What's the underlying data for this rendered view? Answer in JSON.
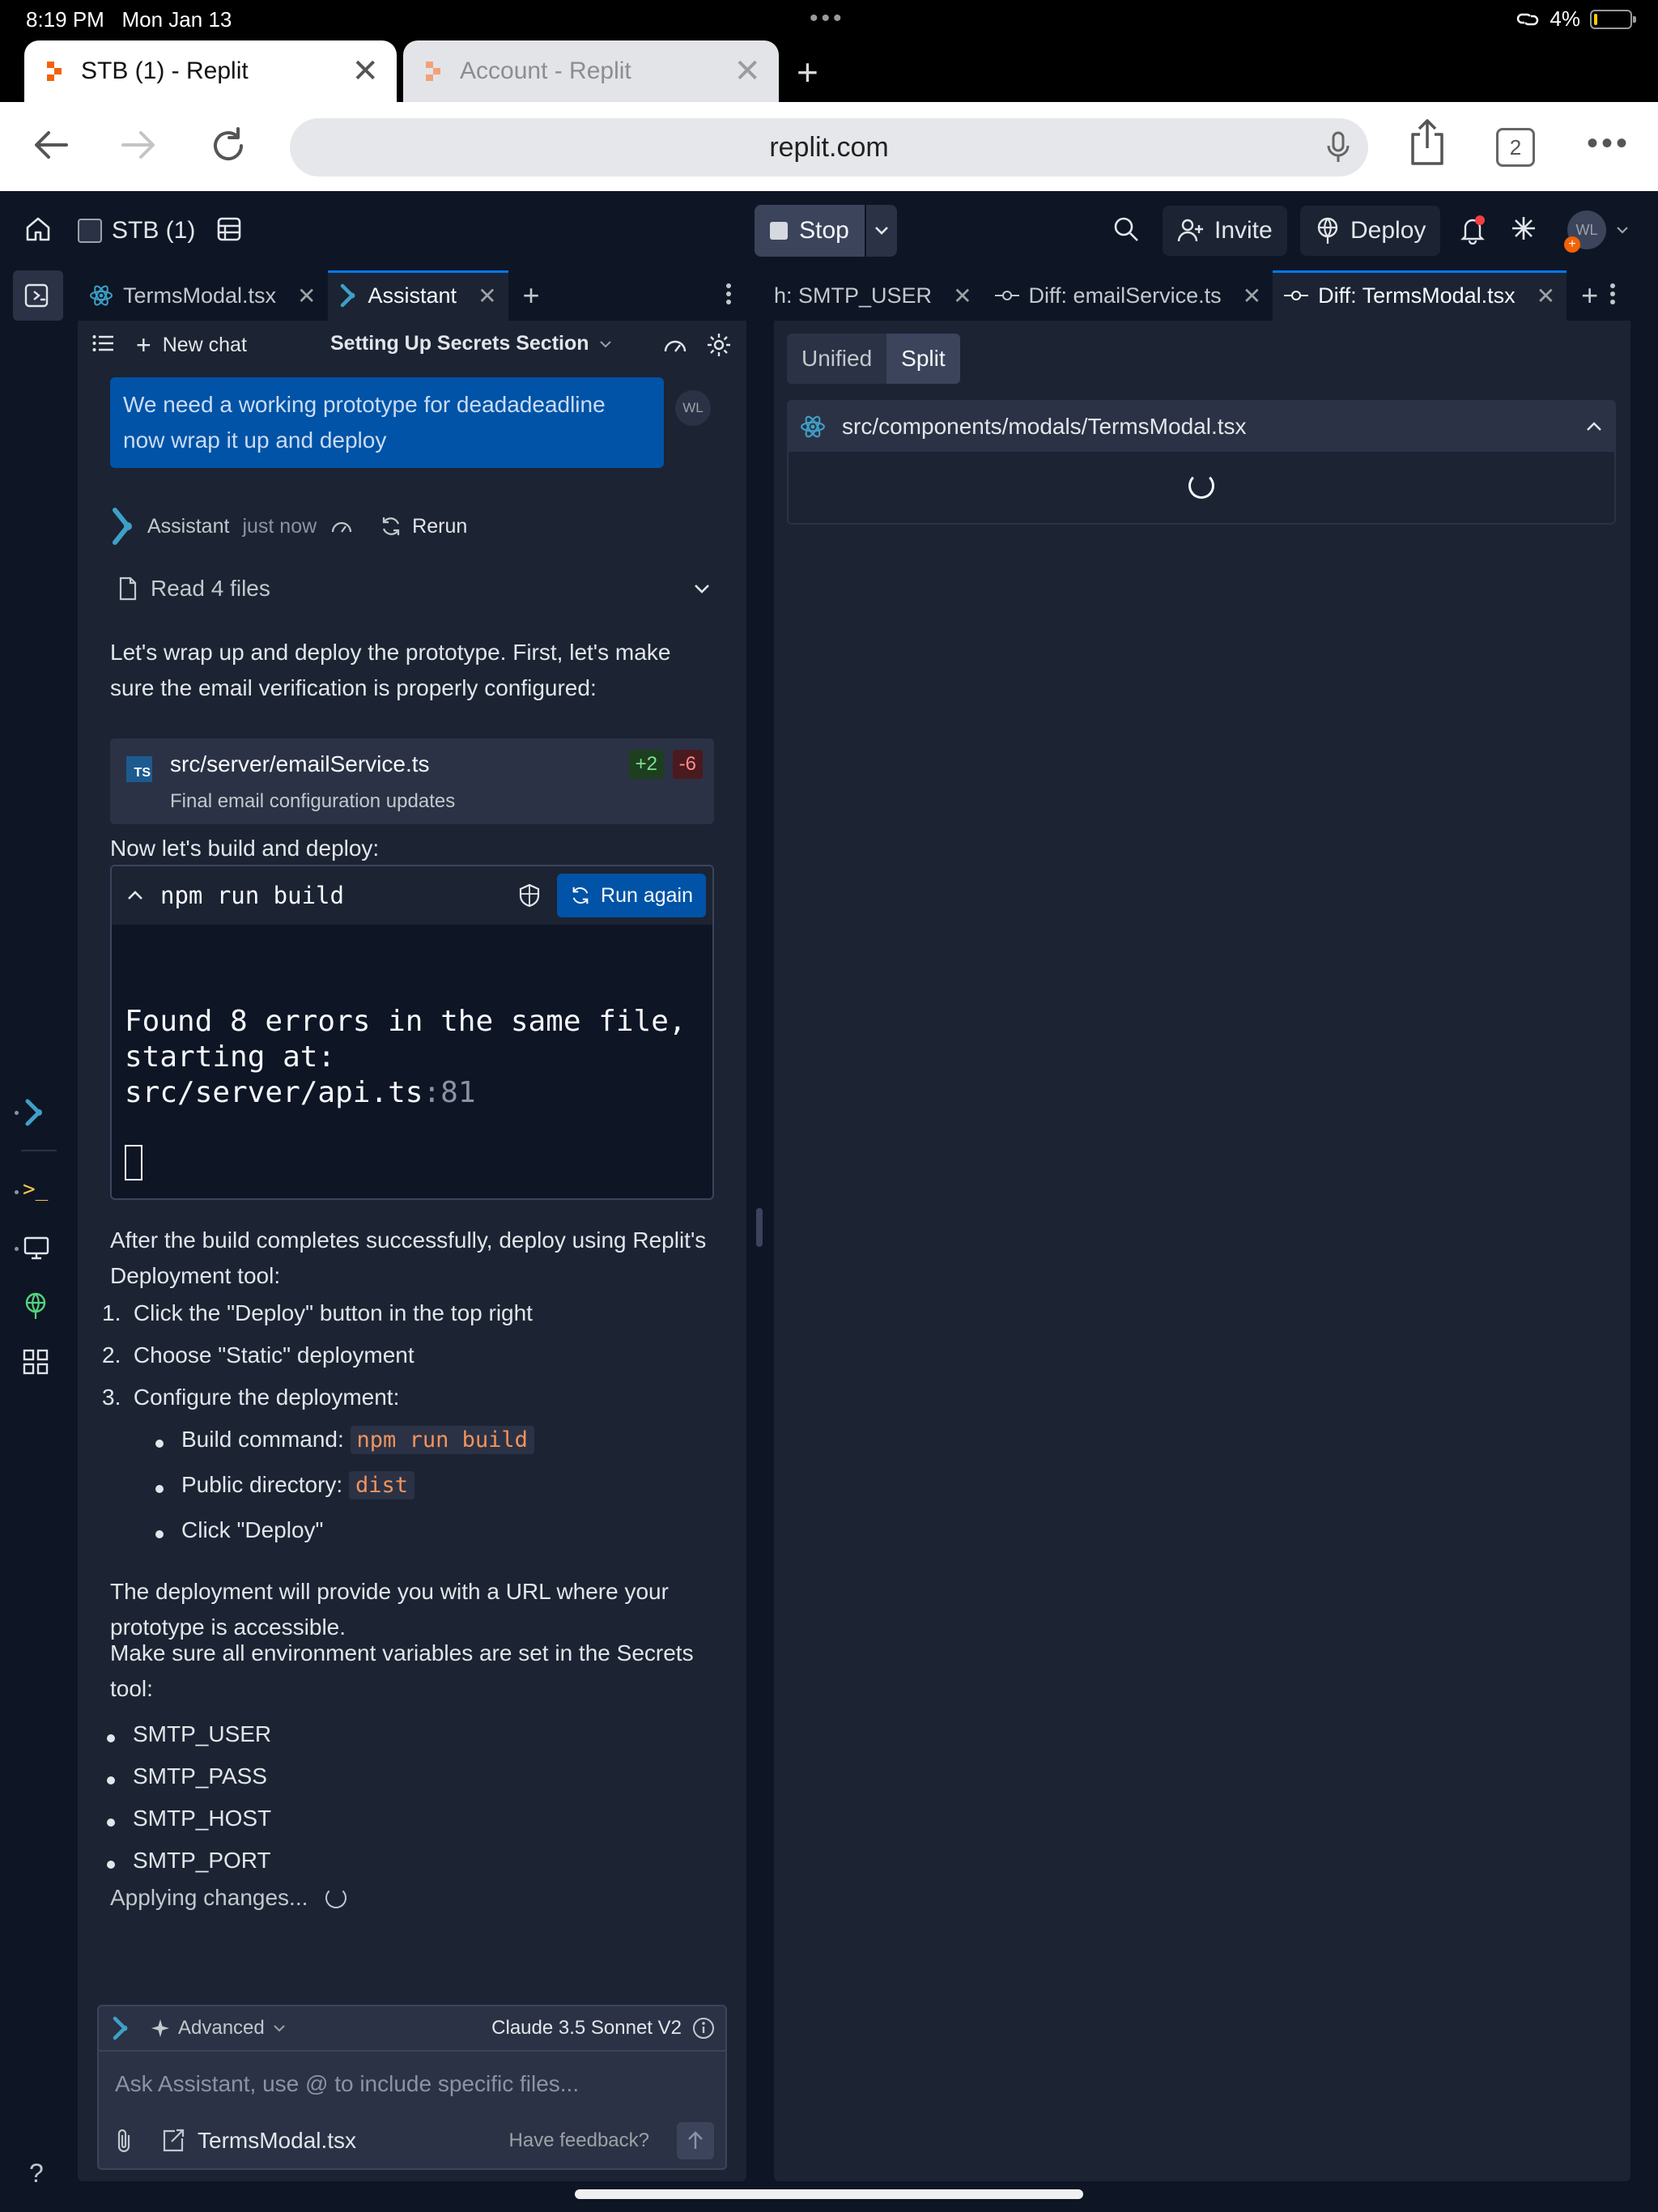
{
  "status_bar": {
    "time": "8:19 PM",
    "date": "Mon Jan 13",
    "battery": "4%"
  },
  "browser": {
    "tabs": [
      {
        "title": "STB (1) - Replit",
        "active": true
      },
      {
        "title": "Account - Replit",
        "active": false
      }
    ],
    "url": "replit.com",
    "tab_count": "2"
  },
  "header": {
    "project_name": "STB (1)",
    "stop_label": "Stop",
    "invite_label": "Invite",
    "deploy_label": "Deploy",
    "avatar_initials": "WL"
  },
  "left_panel": {
    "tabs": [
      {
        "label": "TermsModal.tsx"
      },
      {
        "label": "Assistant"
      }
    ],
    "toolbar": {
      "new_chat": "New chat",
      "chat_title": "Setting Up Secrets Section"
    }
  },
  "chat": {
    "user_message": "We need a working prototype for deadadeadline now wrap it up and deploy",
    "user_initials": "WL",
    "assistant_name": "Assistant",
    "assistant_time": "just now",
    "rerun_label": "Rerun",
    "read_files_label": "Read 4 files",
    "p1": "Let's wrap up and deploy the prototype. First, let's make sure the email verification is properly configured:",
    "file_card": {
      "path": "src/server/emailService.ts",
      "added": "+2",
      "removed": "-6",
      "description": "Final email configuration updates"
    },
    "p2": "Now let's build and deploy:",
    "terminal": {
      "command": "npm run build",
      "run_again": "Run again",
      "output_line1": "Found 8 errors in the same file,",
      "output_line2_prefix": "starting at: src/server/api.ts",
      "output_line2_suffix": ":81"
    },
    "p3": "After the build completes successfully, deploy using Replit's Deployment tool:",
    "steps": [
      "Click the \"Deploy\" button in the top right",
      "Choose \"Static\" deployment",
      "Configure the deployment:"
    ],
    "sub_steps": {
      "build_label": "Build command:",
      "build_code": "npm run build",
      "public_label": "Public directory:",
      "public_code": "dist",
      "click_deploy": "Click \"Deploy\""
    },
    "p4": "The deployment will provide you with a URL where your prototype is accessible.",
    "p5": "Make sure all environment variables are set in the Secrets tool:",
    "env_vars": [
      "SMTP_USER",
      "SMTP_PASS",
      "SMTP_HOST",
      "SMTP_PORT"
    ],
    "applying": "Applying changes..."
  },
  "composer": {
    "mode": "Advanced",
    "model": "Claude 3.5 Sonnet V2",
    "placeholder": "Ask Assistant, use @ to include specific files...",
    "attached_file": "TermsModal.tsx",
    "feedback": "Have feedback?"
  },
  "right_panel": {
    "tabs": [
      {
        "label": "h: SMTP_USER"
      },
      {
        "label": "Diff: emailService.ts"
      },
      {
        "label": "Diff: TermsModal.tsx"
      }
    ],
    "view_modes": [
      "Unified",
      "Split"
    ],
    "active_mode": "Split",
    "diff_file": "src/components/modals/TermsModal.tsx"
  },
  "colors": {
    "accent": "#0079f2",
    "bg": "#0e1525",
    "panel": "#1c2333",
    "user_bubble": "#0053a6",
    "add": "#1d3f1f",
    "remove": "#4a1a1f"
  }
}
